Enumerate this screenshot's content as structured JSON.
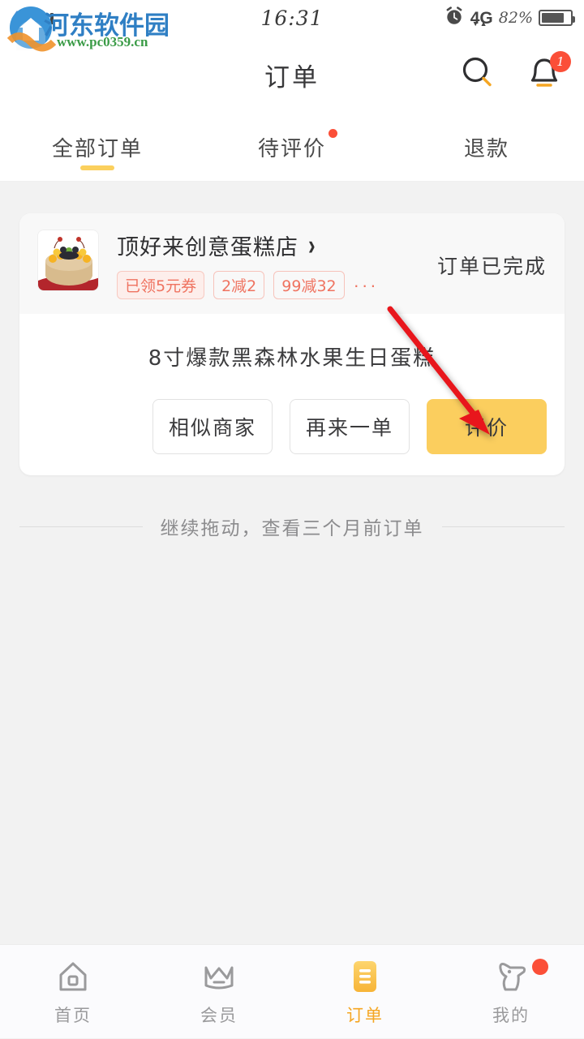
{
  "status_bar": {
    "network": "4G",
    "time": "16:31",
    "battery_percent": "82%",
    "alarm_icon": "alarm-clock-icon",
    "signal_icon": "signal-bars-icon"
  },
  "watermark": {
    "site_name": "河东软件园",
    "url": "www.pc0359.cn"
  },
  "header": {
    "title": "订单",
    "search_icon": "search-icon",
    "bell_icon": "bell-icon",
    "bell_badge": "1"
  },
  "tabs": [
    {
      "label": "全部订单",
      "active": true,
      "dot": false
    },
    {
      "label": "待评价",
      "active": false,
      "dot": true
    },
    {
      "label": "退款",
      "active": false,
      "dot": false
    }
  ],
  "order": {
    "shop_name": "顶好来创意蛋糕店",
    "shop_arrow_icon": "chevron-right-icon",
    "thumbnail_alt": "birthday-cake-photo",
    "tags": [
      {
        "text": "已领5元券",
        "filled": true
      },
      {
        "text": "2减2",
        "filled": false
      },
      {
        "text": "99减32",
        "filled": false
      }
    ],
    "tags_more": "···",
    "status": "订单已完成",
    "product_name": "8寸爆款黑森林水果生日蛋糕",
    "actions": [
      {
        "label": "相似商家",
        "style": "ghost"
      },
      {
        "label": "再来一单",
        "style": "ghost"
      },
      {
        "label": "评价",
        "style": "primary"
      }
    ]
  },
  "pull_hint": "继续拖动，查看三个月前订单",
  "bottom_nav": [
    {
      "label": "首页",
      "icon": "home-icon",
      "active": false,
      "dot": false
    },
    {
      "label": "会员",
      "icon": "crown-icon",
      "active": false,
      "dot": false
    },
    {
      "label": "订单",
      "icon": "order-list-icon",
      "active": true,
      "dot": false
    },
    {
      "label": "我的",
      "icon": "profile-animal-icon",
      "active": false,
      "dot": true
    }
  ],
  "colors": {
    "accent": "#fbce5e",
    "accent_text": "#f5a623",
    "badge_red": "#fb4f38",
    "tag_red": "#ef7360",
    "page_bg": "#f2f2f2",
    "annotation_arrow": "#e8141b"
  },
  "annotation": {
    "type": "arrow",
    "points_to": "评价"
  }
}
